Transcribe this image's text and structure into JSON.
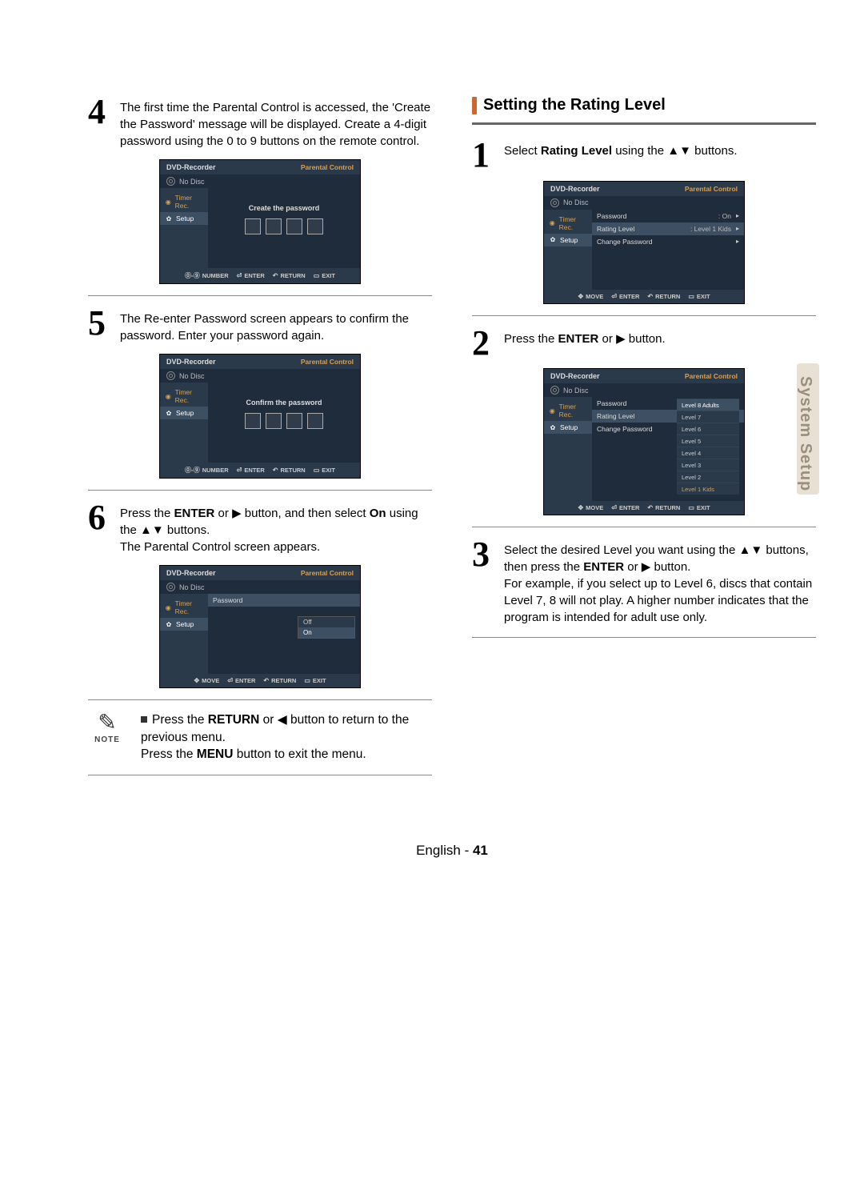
{
  "page": {
    "footer_lang": "English -",
    "footer_num": "41"
  },
  "side_tab": "System Setup",
  "left": {
    "s4": {
      "num": "4",
      "text_a": "The first time the Parental Control is accessed, the 'Create the Password' message will be displayed. Create a 4-digit password using the 0 to 9 buttons on the remote control."
    },
    "s5": {
      "num": "5",
      "text_a": "The Re-enter Password screen appears to confirm the password. Enter your password again."
    },
    "s6": {
      "num": "6",
      "text_a": "Press the ",
      "text_b": "ENTER",
      "text_c": " or ",
      "text_d": " button, and then select ",
      "text_e": "On",
      "text_f": " using the ",
      "text_g": " buttons.",
      "text_h": "The Parental Control screen appears."
    },
    "note": {
      "label": "NOTE",
      "line1_a": "Press the ",
      "line1_b": "RETURN",
      "line1_c": " or ",
      "line1_d": " button to return to the previous menu.",
      "line2_a": "Press the ",
      "line2_b": "MENU",
      "line2_c": " button to exit the menu."
    }
  },
  "right": {
    "title": "Setting the Rating Level",
    "s1": {
      "num": "1",
      "text_a": "Select ",
      "text_b": "Rating Level",
      "text_c": " using the ",
      "text_d": " buttons."
    },
    "s2": {
      "num": "2",
      "text_a": "Press the ",
      "text_b": "ENTER",
      "text_c": " or ",
      "text_d": " button."
    },
    "s3": {
      "num": "3",
      "text_a": "Select the desired Level you want using the ",
      "text_b": " buttons, then press the ",
      "text_c": "ENTER",
      "text_d": " or ",
      "text_e": " button.",
      "text_f": "For example, if you select up to Level 6, discs that contain Level 7, 8 will not play. A higher number indicates that the program is intended for adult use only."
    }
  },
  "osd": {
    "title": "DVD-Recorder",
    "title_r": "Parental Control",
    "nodisc": "No Disc",
    "side": {
      "timer": "Timer Rec.",
      "setup": "Setup"
    },
    "prompt_create": "Create the password",
    "prompt_confirm": "Confirm the password",
    "row_password": "Password",
    "row_rating": "Rating Level",
    "row_change": "Change Password",
    "val_on": ": On",
    "val_lvl1": ": Level 1 Kids",
    "opt_off": "Off",
    "opt_on": "On",
    "levels": [
      "Level  8 Adults",
      "Level  7",
      "Level  6",
      "Level  5",
      "Level  4",
      "Level  3",
      "Level  2",
      "Level  1 Kids"
    ],
    "foot": {
      "number": "NUMBER",
      "enter": "ENTER",
      "return": "RETURN",
      "exit": "EXIT",
      "move": "MOVE"
    }
  }
}
